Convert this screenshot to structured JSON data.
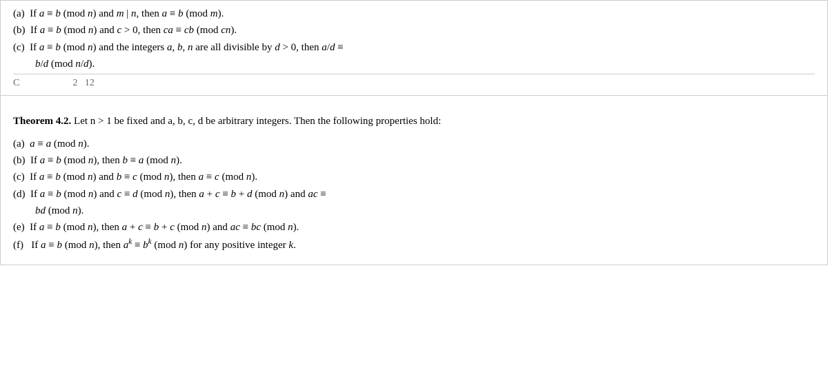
{
  "top_section": {
    "lines": [
      "(a)  If a ≡ b (mod n) and m | n, then a ≡ b (mod m).",
      "(b)  If a ≡ b (mod n) and c > 0, then ca ≡ cb (mod cn).",
      "(c)  If a ≡ b (mod n) and the integers a, b, n are all divisible by d > 0, then a/d ≡ b/d (mod n/d).",
      "C...  ...  ...  2  12  ...  ...  ...  ...  ...  ..."
    ]
  },
  "theorem_section": {
    "theorem_label": "Theorem 4.2.",
    "theorem_intro": " Let n > 1 be fixed and a, b, c, d be arbitrary integers. Then the following properties hold:",
    "properties": [
      {
        "label": "(a)",
        "text": "a ≡ a (mod n)."
      },
      {
        "label": "(b)",
        "text": "If a ≡ b (mod n), then b ≡ a (mod n)."
      },
      {
        "label": "(c)",
        "text": "If a ≡ b (mod n) and b ≡ c (mod n), then a ≡ c (mod n)."
      },
      {
        "label": "(d)",
        "text": "If a ≡ b (mod n) and c ≡ d (mod n), then a + c ≡ b + d (mod n) and ac ≡ bd (mod n)."
      },
      {
        "label": "(e)",
        "text": "If a ≡ b (mod n), then a + c ≡ b + c (mod n) and ac ≡ bc (mod n)."
      },
      {
        "label": "(f)",
        "text": "If a ≡ b (mod n), then aᵏ ≡ bᵏ (mod n) for any positive integer k."
      }
    ]
  }
}
